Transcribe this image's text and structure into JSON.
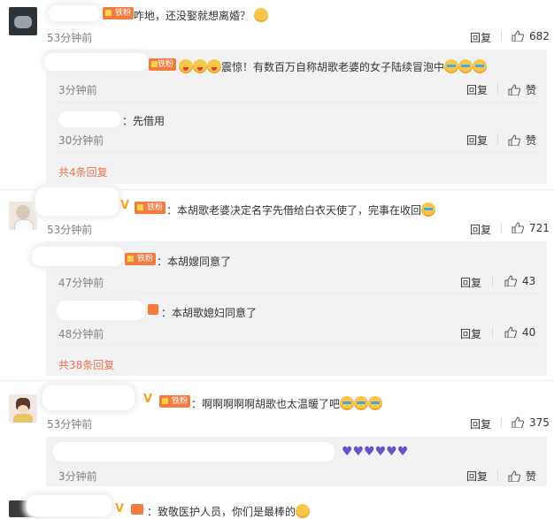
{
  "comments": [
    {
      "text": "咋地，还没娶就想离婚？",
      "time": "53分钟前",
      "reply_label": "回复",
      "likes": "682",
      "replies": [
        {
          "text": "震惊！有数百万自称胡歌老婆的女子陆续冒泡中",
          "time": "3分钟前",
          "reply_label": "回复",
          "like_label": "赞"
        },
        {
          "text": "：先借用",
          "time": "30分钟前",
          "reply_label": "回复",
          "like_label": "赞"
        }
      ],
      "more_replies": "共4条回复"
    },
    {
      "text": "：本胡歌老婆决定名字先借给白衣天使了，完事在收回",
      "time": "53分钟前",
      "reply_label": "回复",
      "likes": "721",
      "replies": [
        {
          "text": "：本胡嫂同意了",
          "time": "47分钟前",
          "reply_label": "回复",
          "likes": "43"
        },
        {
          "text": "：本胡歌媳妇同意了",
          "time": "48分钟前",
          "reply_label": "回复",
          "likes": "40"
        }
      ],
      "more_replies": "共38条回复"
    },
    {
      "text": "：啊啊啊啊啊胡歌也太温暖了吧",
      "time": "53分钟前",
      "reply_label": "回复",
      "likes": "375",
      "replies": [
        {
          "text": "",
          "time": "3分钟前",
          "reply_label": "回复",
          "like_label": "赞"
        }
      ]
    },
    {
      "text": "：致敬医护人员，你们是最棒的"
    }
  ],
  "badge_label": "铁粉",
  "vip_mark": "V",
  "icons": {
    "like": "thumbs-up-icon",
    "badge": "fan-badge-icon",
    "emoji": "emoji-icon",
    "heart": "purple-heart-icon"
  },
  "colors": {
    "link": "#eb7350",
    "badge": "#f27b40",
    "panel": "#f2f2f5"
  }
}
